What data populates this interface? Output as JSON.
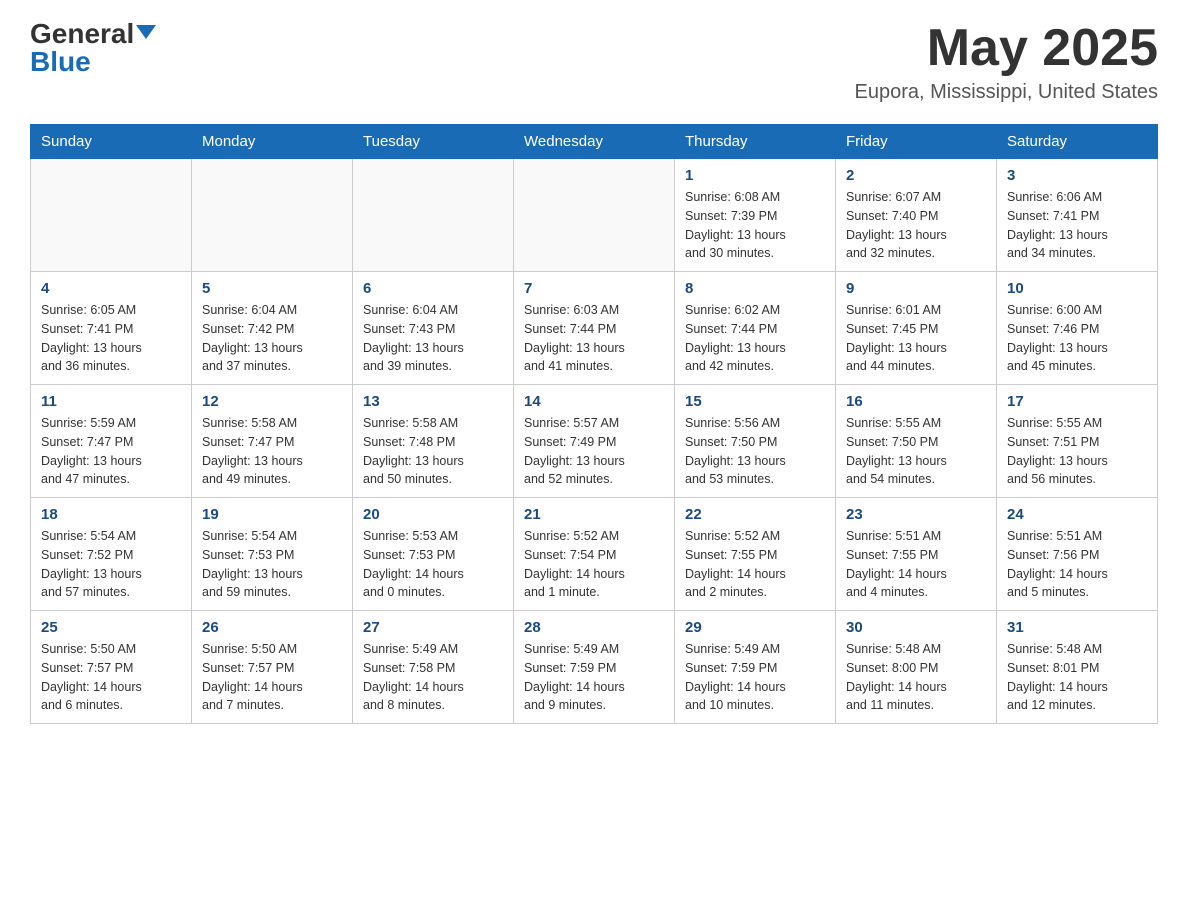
{
  "logo": {
    "text_general": "General",
    "text_blue": "Blue",
    "alt": "GeneralBlue logo"
  },
  "header": {
    "month_year": "May 2025",
    "location": "Eupora, Mississippi, United States"
  },
  "weekdays": [
    "Sunday",
    "Monday",
    "Tuesday",
    "Wednesday",
    "Thursday",
    "Friday",
    "Saturday"
  ],
  "weeks": [
    [
      {
        "day": "",
        "info": ""
      },
      {
        "day": "",
        "info": ""
      },
      {
        "day": "",
        "info": ""
      },
      {
        "day": "",
        "info": ""
      },
      {
        "day": "1",
        "info": "Sunrise: 6:08 AM\nSunset: 7:39 PM\nDaylight: 13 hours\nand 30 minutes."
      },
      {
        "day": "2",
        "info": "Sunrise: 6:07 AM\nSunset: 7:40 PM\nDaylight: 13 hours\nand 32 minutes."
      },
      {
        "day": "3",
        "info": "Sunrise: 6:06 AM\nSunset: 7:41 PM\nDaylight: 13 hours\nand 34 minutes."
      }
    ],
    [
      {
        "day": "4",
        "info": "Sunrise: 6:05 AM\nSunset: 7:41 PM\nDaylight: 13 hours\nand 36 minutes."
      },
      {
        "day": "5",
        "info": "Sunrise: 6:04 AM\nSunset: 7:42 PM\nDaylight: 13 hours\nand 37 minutes."
      },
      {
        "day": "6",
        "info": "Sunrise: 6:04 AM\nSunset: 7:43 PM\nDaylight: 13 hours\nand 39 minutes."
      },
      {
        "day": "7",
        "info": "Sunrise: 6:03 AM\nSunset: 7:44 PM\nDaylight: 13 hours\nand 41 minutes."
      },
      {
        "day": "8",
        "info": "Sunrise: 6:02 AM\nSunset: 7:44 PM\nDaylight: 13 hours\nand 42 minutes."
      },
      {
        "day": "9",
        "info": "Sunrise: 6:01 AM\nSunset: 7:45 PM\nDaylight: 13 hours\nand 44 minutes."
      },
      {
        "day": "10",
        "info": "Sunrise: 6:00 AM\nSunset: 7:46 PM\nDaylight: 13 hours\nand 45 minutes."
      }
    ],
    [
      {
        "day": "11",
        "info": "Sunrise: 5:59 AM\nSunset: 7:47 PM\nDaylight: 13 hours\nand 47 minutes."
      },
      {
        "day": "12",
        "info": "Sunrise: 5:58 AM\nSunset: 7:47 PM\nDaylight: 13 hours\nand 49 minutes."
      },
      {
        "day": "13",
        "info": "Sunrise: 5:58 AM\nSunset: 7:48 PM\nDaylight: 13 hours\nand 50 minutes."
      },
      {
        "day": "14",
        "info": "Sunrise: 5:57 AM\nSunset: 7:49 PM\nDaylight: 13 hours\nand 52 minutes."
      },
      {
        "day": "15",
        "info": "Sunrise: 5:56 AM\nSunset: 7:50 PM\nDaylight: 13 hours\nand 53 minutes."
      },
      {
        "day": "16",
        "info": "Sunrise: 5:55 AM\nSunset: 7:50 PM\nDaylight: 13 hours\nand 54 minutes."
      },
      {
        "day": "17",
        "info": "Sunrise: 5:55 AM\nSunset: 7:51 PM\nDaylight: 13 hours\nand 56 minutes."
      }
    ],
    [
      {
        "day": "18",
        "info": "Sunrise: 5:54 AM\nSunset: 7:52 PM\nDaylight: 13 hours\nand 57 minutes."
      },
      {
        "day": "19",
        "info": "Sunrise: 5:54 AM\nSunset: 7:53 PM\nDaylight: 13 hours\nand 59 minutes."
      },
      {
        "day": "20",
        "info": "Sunrise: 5:53 AM\nSunset: 7:53 PM\nDaylight: 14 hours\nand 0 minutes."
      },
      {
        "day": "21",
        "info": "Sunrise: 5:52 AM\nSunset: 7:54 PM\nDaylight: 14 hours\nand 1 minute."
      },
      {
        "day": "22",
        "info": "Sunrise: 5:52 AM\nSunset: 7:55 PM\nDaylight: 14 hours\nand 2 minutes."
      },
      {
        "day": "23",
        "info": "Sunrise: 5:51 AM\nSunset: 7:55 PM\nDaylight: 14 hours\nand 4 minutes."
      },
      {
        "day": "24",
        "info": "Sunrise: 5:51 AM\nSunset: 7:56 PM\nDaylight: 14 hours\nand 5 minutes."
      }
    ],
    [
      {
        "day": "25",
        "info": "Sunrise: 5:50 AM\nSunset: 7:57 PM\nDaylight: 14 hours\nand 6 minutes."
      },
      {
        "day": "26",
        "info": "Sunrise: 5:50 AM\nSunset: 7:57 PM\nDaylight: 14 hours\nand 7 minutes."
      },
      {
        "day": "27",
        "info": "Sunrise: 5:49 AM\nSunset: 7:58 PM\nDaylight: 14 hours\nand 8 minutes."
      },
      {
        "day": "28",
        "info": "Sunrise: 5:49 AM\nSunset: 7:59 PM\nDaylight: 14 hours\nand 9 minutes."
      },
      {
        "day": "29",
        "info": "Sunrise: 5:49 AM\nSunset: 7:59 PM\nDaylight: 14 hours\nand 10 minutes."
      },
      {
        "day": "30",
        "info": "Sunrise: 5:48 AM\nSunset: 8:00 PM\nDaylight: 14 hours\nand 11 minutes."
      },
      {
        "day": "31",
        "info": "Sunrise: 5:48 AM\nSunset: 8:01 PM\nDaylight: 14 hours\nand 12 minutes."
      }
    ]
  ]
}
